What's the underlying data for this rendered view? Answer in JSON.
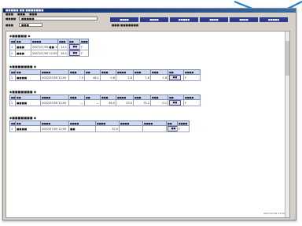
{
  "window": {
    "title": "■■■■■ ■■ ■■■■■■■",
    "menu": [
      "■■■",
      "■■■",
      "■■■"
    ]
  },
  "toolbar": {
    "label1": "■■■■",
    "value1": "■■■■■",
    "label2": "■■■",
    "value2": "■■■",
    "tabs": [
      "■■■■",
      "■■■■",
      "■■■■■",
      "■■■■",
      "■■■■",
      "■■■■■"
    ],
    "note": "■■■ ■■■■■■■"
  },
  "sections": [
    {
      "title": "■■■■■",
      "headers": [
        "■■",
        "■■",
        "■■■■",
        "■■■",
        "■■",
        "■■■■",
        "",
        ""
      ],
      "rows": [
        [
          "1",
          "■■■",
          "2007/07/09 ■■ 10:0",
          "14.1",
          "■■",
          "F"
        ],
        [
          "2",
          "■■■",
          "2007/07/09 12:00",
          "16.1",
          "■■",
          "F"
        ]
      ]
    },
    {
      "title": "■■■■■■■",
      "headers": [
        "■■",
        "■■",
        "■■■■",
        "■■■",
        "■■",
        "■■■",
        "■■■■",
        "■■■",
        "■■■",
        "■■",
        "■■■■"
      ],
      "rows": [
        [
          "1",
          "■■■■",
          "2007/07/09 12:00",
          "7.0",
          "48.1",
          "0.8",
          "2.8",
          "7.8",
          "1.8",
          "■■",
          "F"
        ]
      ]
    },
    {
      "title": "■■■■■■■",
      "headers": [
        "■■",
        "■■",
        "■■■■",
        "■■■",
        "■■",
        "■■■",
        "■■■■",
        "■■■",
        "■■■",
        "■■",
        "■■■■"
      ],
      "rows": [
        [
          "1",
          "■■■■",
          "2007/07/09 12:00",
          "—",
          "—",
          "46.0",
          "23.0",
          "75.2",
          "0.1",
          "■■",
          "F"
        ]
      ]
    },
    {
      "title": "■■■■■■■",
      "headers": [
        "■■",
        "■■",
        "■■■■",
        "■■■■",
        "■■■■",
        "■■■■",
        "■■■■",
        "■■",
        "■■■■"
      ],
      "rows": [
        [
          "1",
          "■■■■",
          "2007/07/09 12:00",
          "■■",
          "32.0",
          "",
          "",
          "■■",
          "F"
        ]
      ]
    }
  ],
  "status": "2007/07/09 12:00"
}
